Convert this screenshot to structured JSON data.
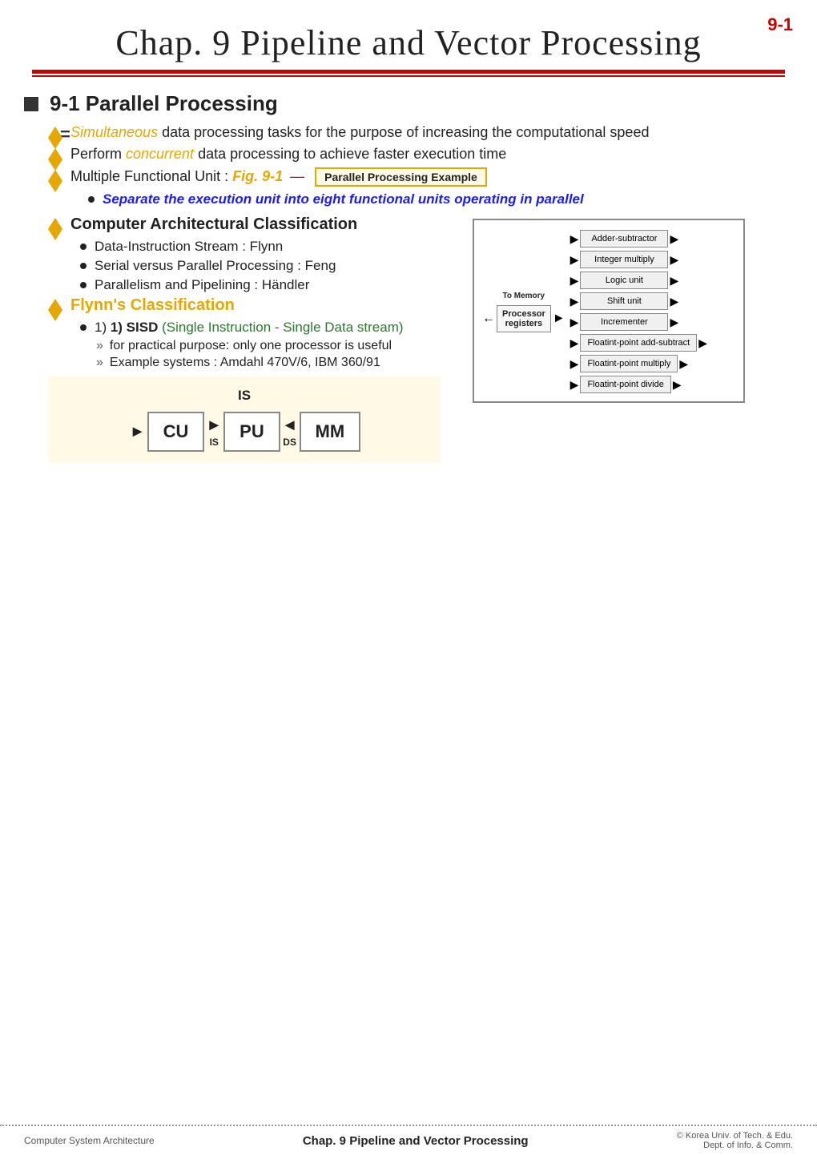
{
  "page": {
    "number": "9-1",
    "title": "Chap. 9  Pipeline and Vector Processing"
  },
  "section1": {
    "heading": "9-1  Parallel Processing",
    "bullet1": {
      "prefix_italic": "Simultaneous",
      "rest": " data processing tasks for the purpose of increasing the computational speed"
    },
    "bullet2": {
      "prefix": "Perform ",
      "italic": "concurrent",
      "rest": " data processing to achieve faster execution time"
    },
    "bullet3": {
      "prefix": "Multiple Functional Unit : ",
      "fig": "Fig. 9-1",
      "label": "Parallel Processing Example",
      "sub": "Separate the execution unit into eight functional units operating in parallel"
    },
    "bullet4": {
      "text": "Computer Architectural Classification",
      "sub1": "Data-Instruction Stream : Flynn",
      "sub2": "Serial versus Parallel Processing : Feng",
      "sub3": "Parallelism and Pipelining : Händler"
    },
    "bullet5": {
      "heading": "Flynn's Classification",
      "sisd_label": "1) SISD",
      "sisd_full": "(Single Instruction - Single Data stream)",
      "sisd_sub1": "for practical purpose: only one processor is useful",
      "sisd_sub2": "Example systems : Amdahl 470V/6,  IBM 360/91",
      "diagram_label": "IS"
    }
  },
  "right_diagram": {
    "to_memory": "To Memory",
    "proc_regs": "Processor\nregisters",
    "units": [
      "Adder-subtractor",
      "Integer multiply",
      "Logic unit",
      "Shift unit",
      "Incrementer",
      "Floatint-point\nadd-subtract",
      "Floatint-point\nmultiply",
      "Floatint-point\ndivide"
    ]
  },
  "sisd_boxes": {
    "cu": "CU",
    "is": "IS",
    "pu": "PU",
    "ds": "DS",
    "mm": "MM"
  },
  "footer": {
    "left": "Computer System Architecture",
    "center": "Chap. 9  Pipeline and Vector Processing",
    "right_line1": "© Korea Univ. of Tech. & Edu.",
    "right_line2": "Dept. of Info. & Comm."
  }
}
